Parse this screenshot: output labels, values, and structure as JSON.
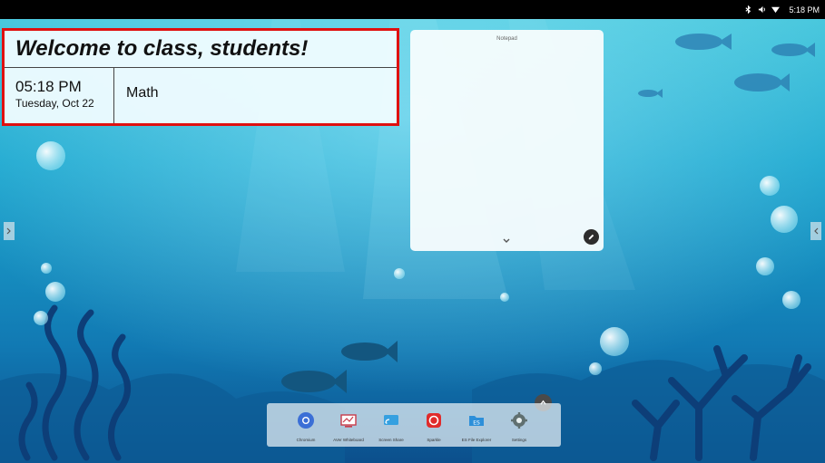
{
  "status_bar": {
    "time": "5:18 PM",
    "icons": [
      "bluetooth-icon",
      "volume-icon",
      "wifi-icon"
    ]
  },
  "welcome_widget": {
    "title": "Welcome to class, students!",
    "time": "05:18 PM",
    "date": "Tuesday, Oct 22",
    "subject": "Math",
    "highlight_color": "#e01010"
  },
  "notepad": {
    "title": "Notepad",
    "icons": [
      "chevron-down-icon",
      "pen-icon"
    ]
  },
  "dock": {
    "apps": [
      {
        "label": "Chromium",
        "icon": "chromium-icon",
        "color": "#3b6fd6"
      },
      {
        "label": "AVer Whiteboard",
        "icon": "whiteboard-icon",
        "color": "#c93b4a"
      },
      {
        "label": "Screen Share",
        "icon": "screen-share-icon",
        "color": "#35a0e0"
      },
      {
        "label": "Sparkle",
        "icon": "sparkle-icon",
        "color": "#e02b2b"
      },
      {
        "label": "ES File Explorer",
        "icon": "folder-icon",
        "color": "#2d8fd9"
      },
      {
        "label": "Settings",
        "icon": "gear-icon",
        "color": "#607070"
      }
    ]
  },
  "colors": {
    "wallpaper_top": "#3ec6dc",
    "wallpaper_bottom": "#0a4f8f"
  }
}
